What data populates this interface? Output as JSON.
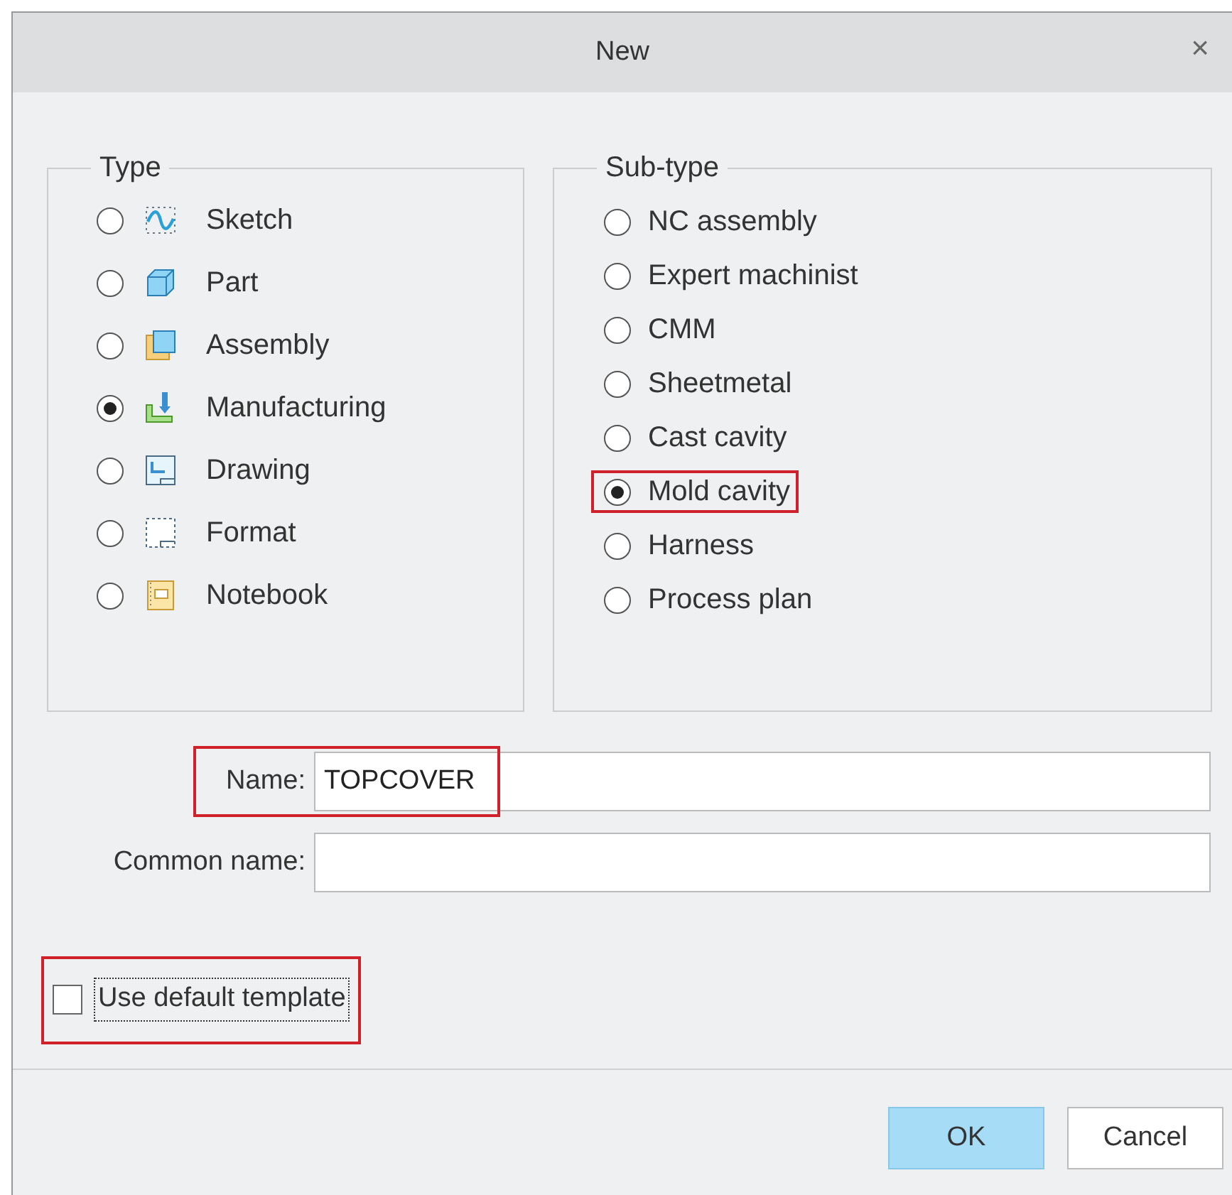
{
  "window": {
    "title": "New",
    "close": "×"
  },
  "type_group": {
    "title": "Type",
    "items": [
      {
        "label": "Sketch",
        "kind": "sketch",
        "selected": false
      },
      {
        "label": "Part",
        "kind": "part",
        "selected": false
      },
      {
        "label": "Assembly",
        "kind": "assembly",
        "selected": false
      },
      {
        "label": "Manufacturing",
        "kind": "manufacturing",
        "selected": true
      },
      {
        "label": "Drawing",
        "kind": "drawing",
        "selected": false
      },
      {
        "label": "Format",
        "kind": "format",
        "selected": false
      },
      {
        "label": "Notebook",
        "kind": "notebook",
        "selected": false
      }
    ]
  },
  "subtype_group": {
    "title": "Sub-type",
    "items": [
      {
        "label": "NC assembly",
        "selected": false,
        "highlighted": false
      },
      {
        "label": "Expert machinist",
        "selected": false,
        "highlighted": false
      },
      {
        "label": "CMM",
        "selected": false,
        "highlighted": false
      },
      {
        "label": "Sheetmetal",
        "selected": false,
        "highlighted": false
      },
      {
        "label": "Cast cavity",
        "selected": false,
        "highlighted": false
      },
      {
        "label": "Mold cavity",
        "selected": true,
        "highlighted": true
      },
      {
        "label": "Harness",
        "selected": false,
        "highlighted": false
      },
      {
        "label": "Process plan",
        "selected": false,
        "highlighted": false
      }
    ]
  },
  "name_field": {
    "label": "Name:",
    "value": "TOPCOVER",
    "highlighted": true
  },
  "common_name_field": {
    "label": "Common name:"
  },
  "default_template": {
    "label": "Use default template",
    "checked": false,
    "highlighted": true
  },
  "buttons": [
    {
      "label": "OK",
      "kind": "primary"
    },
    {
      "label": "Cancel",
      "kind": "secondary"
    }
  ]
}
